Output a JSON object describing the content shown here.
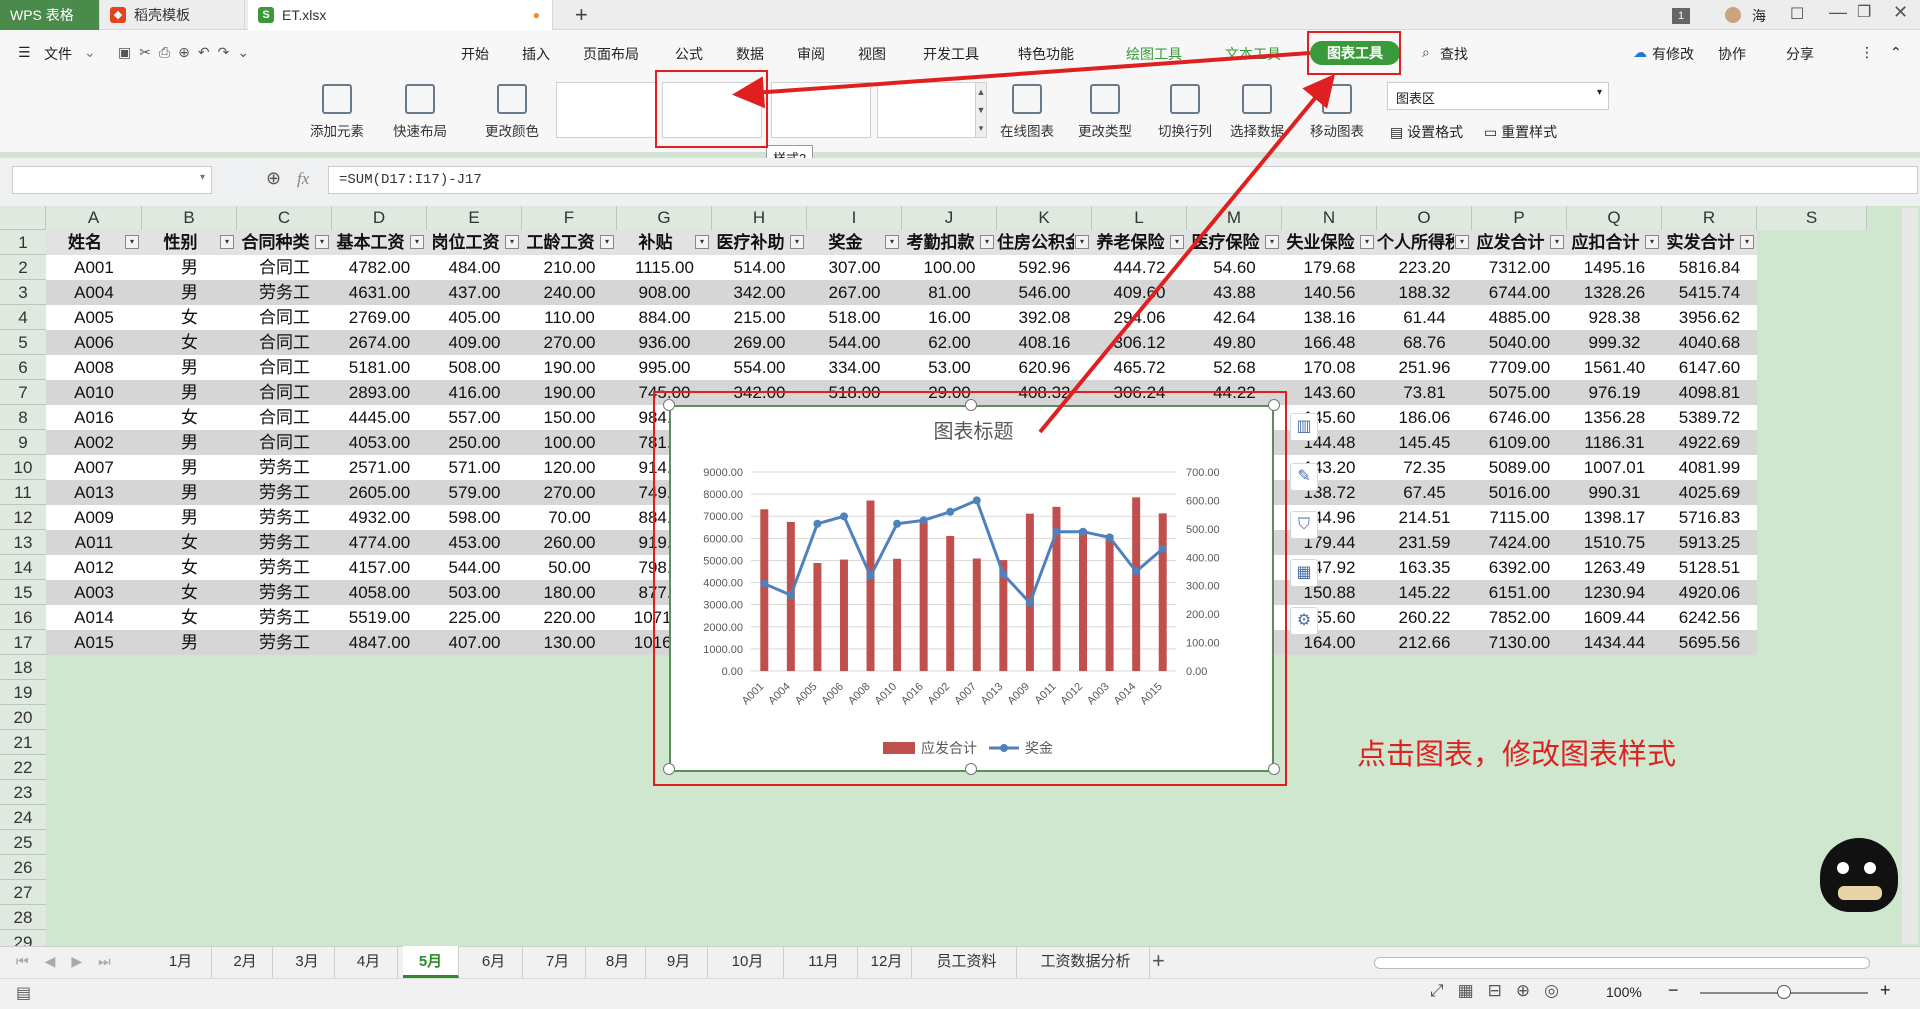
{
  "tabs": [
    {
      "label": "WPS 表格",
      "active": true
    },
    {
      "label": "稻壳模板"
    },
    {
      "label": "ET.xlsx"
    }
  ],
  "titlebar": {
    "badge": "1",
    "user": "海"
  },
  "menu": {
    "file": "文件",
    "items": [
      "开始",
      "插入",
      "页面布局",
      "公式",
      "数据",
      "审阅",
      "视图",
      "开发工具",
      "特色功能",
      "绘图工具",
      "文本工具"
    ],
    "active": "图表工具",
    "search": "查找",
    "right": [
      "有修改",
      "协作",
      "分享"
    ]
  },
  "ribbon": {
    "add_element": "添加元素",
    "quick_layout": "快速布局",
    "change_color": "更改颜色",
    "online_chart": "在线图表",
    "change_type": "更改类型",
    "switch_rowcol": "切换行列",
    "select_data": "选择数据",
    "move_chart": "移动图表",
    "chart_area": "图表区",
    "set_format": "设置格式",
    "reset_style": "重置样式",
    "tooltip": "样式2"
  },
  "formula": {
    "namebox": "",
    "fx": "fx",
    "text": "=SUM(D17:I17)-J17"
  },
  "columns": [
    "A",
    "B",
    "C",
    "D",
    "E",
    "F",
    "G",
    "H",
    "I",
    "J",
    "K",
    "L",
    "M",
    "N",
    "O",
    "P",
    "Q",
    "R",
    "S"
  ],
  "headers": [
    "姓名",
    "性别",
    "合同种类",
    "基本工资",
    "岗位工资",
    "工龄工资",
    "补贴",
    "医疗补助",
    "奖金",
    "考勤扣款",
    "住房公积金",
    "养老保险",
    "医疗保险",
    "失业保险",
    "个人所得税",
    "应发合计",
    "应扣合计",
    "实发合计"
  ],
  "rows": [
    [
      "A001",
      "男",
      "合同工",
      "4782.00",
      "484.00",
      "210.00",
      "1115.00",
      "514.00",
      "307.00",
      "100.00",
      "592.96",
      "444.72",
      "54.60",
      "179.68",
      "223.20",
      "7312.00",
      "1495.16",
      "5816.84"
    ],
    [
      "A004",
      "男",
      "劳务工",
      "4631.00",
      "437.00",
      "240.00",
      "908.00",
      "342.00",
      "267.00",
      "81.00",
      "546.00",
      "409.60",
      "43.88",
      "140.56",
      "188.32",
      "6744.00",
      "1328.26",
      "5415.74"
    ],
    [
      "A005",
      "女",
      "合同工",
      "2769.00",
      "405.00",
      "110.00",
      "884.00",
      "215.00",
      "518.00",
      "16.00",
      "392.08",
      "294.06",
      "42.64",
      "138.16",
      "61.44",
      "4885.00",
      "928.38",
      "3956.62"
    ],
    [
      "A006",
      "女",
      "合同工",
      "2674.00",
      "409.00",
      "270.00",
      "936.00",
      "269.00",
      "544.00",
      "62.00",
      "408.16",
      "306.12",
      "49.80",
      "166.48",
      "68.76",
      "5040.00",
      "999.32",
      "4040.68"
    ],
    [
      "A008",
      "男",
      "合同工",
      "5181.00",
      "508.00",
      "190.00",
      "995.00",
      "554.00",
      "334.00",
      "53.00",
      "620.96",
      "465.72",
      "52.68",
      "170.08",
      "251.96",
      "7709.00",
      "1561.40",
      "6147.60"
    ],
    [
      "A010",
      "男",
      "合同工",
      "2893.00",
      "416.00",
      "190.00",
      "745.00",
      "342.00",
      "518.00",
      "29.00",
      "408.32",
      "306.24",
      "44.22",
      "143.60",
      "73.81",
      "5075.00",
      "976.19",
      "4098.81"
    ],
    [
      "A016",
      "女",
      "合同工",
      "4445.00",
      "557.00",
      "150.00",
      "984.00",
      "",
      "",
      "",
      "",
      "",
      "",
      "145.60",
      "186.06",
      "6746.00",
      "1356.28",
      "5389.72"
    ],
    [
      "A002",
      "男",
      "合同工",
      "4053.00",
      "250.00",
      "100.00",
      "781.00",
      "",
      "",
      "",
      "",
      "",
      "",
      "144.48",
      "145.45",
      "6109.00",
      "1186.31",
      "4922.69"
    ],
    [
      "A007",
      "男",
      "劳务工",
      "2571.00",
      "571.00",
      "120.00",
      "914.00",
      "",
      "",
      "",
      "",
      "",
      "",
      "143.20",
      "72.35",
      "5089.00",
      "1007.01",
      "4081.99"
    ],
    [
      "A013",
      "男",
      "劳务工",
      "2605.00",
      "579.00",
      "270.00",
      "749.00",
      "",
      "",
      "",
      "",
      "",
      "",
      "138.72",
      "67.45",
      "5016.00",
      "990.31",
      "4025.69"
    ],
    [
      "A009",
      "男",
      "劳务工",
      "4932.00",
      "598.00",
      "70.00",
      "884.00",
      "",
      "",
      "",
      "",
      "",
      "",
      "144.96",
      "214.51",
      "7115.00",
      "1398.17",
      "5716.83"
    ],
    [
      "A011",
      "女",
      "劳务工",
      "4774.00",
      "453.00",
      "260.00",
      "919.00",
      "",
      "",
      "",
      "",
      "",
      "",
      "179.44",
      "231.59",
      "7424.00",
      "1510.75",
      "5913.25"
    ],
    [
      "A012",
      "女",
      "劳务工",
      "4157.00",
      "544.00",
      "50.00",
      "798.00",
      "",
      "",
      "",
      "",
      "",
      "",
      "147.92",
      "163.35",
      "6392.00",
      "1263.49",
      "5128.51"
    ],
    [
      "A003",
      "女",
      "劳务工",
      "4058.00",
      "503.00",
      "180.00",
      "877.00",
      "",
      "",
      "",
      "",
      "",
      "",
      "150.88",
      "145.22",
      "6151.00",
      "1230.94",
      "4920.06"
    ],
    [
      "A014",
      "女",
      "劳务工",
      "5519.00",
      "225.00",
      "220.00",
      "1071.00",
      "",
      "",
      "",
      "",
      "",
      "",
      "155.60",
      "260.22",
      "7852.00",
      "1609.44",
      "6242.56"
    ],
    [
      "A015",
      "男",
      "劳务工",
      "4847.00",
      "407.00",
      "130.00",
      "1016.00",
      "",
      "",
      "",
      "",
      "",
      "",
      "164.00",
      "212.66",
      "7130.00",
      "1434.44",
      "5695.56"
    ]
  ],
  "row_numbers": [
    "1",
    "2",
    "3",
    "4",
    "5",
    "6",
    "7",
    "8",
    "9",
    "10",
    "11",
    "12",
    "13",
    "14",
    "15",
    "16",
    "17",
    "18",
    "19",
    "20",
    "21",
    "22",
    "23",
    "24",
    "25",
    "26",
    "27",
    "28",
    "29"
  ],
  "chart_data": {
    "type": "bar",
    "title": "图表标题",
    "categories": [
      "A001",
      "A004",
      "A005",
      "A006",
      "A008",
      "A010",
      "A016",
      "A002",
      "A007",
      "A013",
      "A009",
      "A011",
      "A012",
      "A003",
      "A014",
      "A015"
    ],
    "series": [
      {
        "name": "应发合计",
        "type": "bar",
        "axis": "left",
        "color": "#c0504d",
        "values": [
          7312,
          6744,
          4885,
          5040,
          7709,
          5075,
          6746,
          6109,
          5089,
          5016,
          7115,
          7424,
          6392,
          6151,
          7852,
          7130
        ]
      },
      {
        "name": "奖金",
        "type": "line",
        "axis": "right",
        "color": "#4f81bd",
        "values": [
          307,
          267,
          518,
          544,
          334,
          518,
          530,
          560,
          600,
          340,
          240,
          490,
          490,
          470,
          350,
          430
        ]
      }
    ],
    "ylim": [
      0,
      9000
    ],
    "yticks": [
      "9000.00",
      "8000.00",
      "7000.00",
      "6000.00",
      "5000.00",
      "4000.00",
      "3000.00",
      "2000.00",
      "1000.00",
      "0.00"
    ],
    "y2lim": [
      0,
      700
    ],
    "y2ticks": [
      "700.00",
      "600.00",
      "500.00",
      "400.00",
      "300.00",
      "200.00",
      "100.00",
      "0.00"
    ],
    "legend": "bottom",
    "grid": true
  },
  "annotation": "点击图表，修改图表样式",
  "sheets": [
    "1月",
    "2月",
    "3月",
    "4月",
    "5月",
    "6月",
    "7月",
    "8月",
    "9月",
    "10月",
    "11月",
    "12月",
    "员工资料",
    "工资数据分析"
  ],
  "active_sheet": "5月",
  "zoom": "100%"
}
